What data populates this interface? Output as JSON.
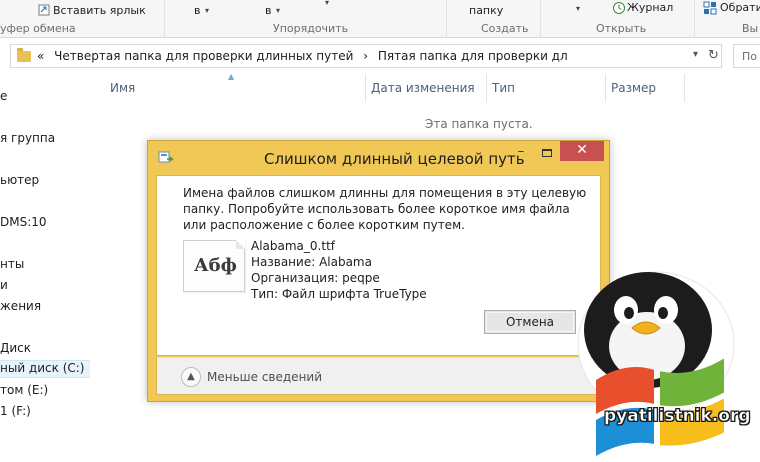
{
  "ribbon": {
    "paste_shortcut": "Вставить ярлык",
    "clipboard_group": "уфер обмена",
    "dd1": "в",
    "dd2": "в",
    "organize_group": "Упорядочить",
    "new_folder": "папку",
    "create_group": "Создать",
    "journal": "Журнал",
    "open_group": "Открыть",
    "access": "Обрати",
    "select_group": "Вы"
  },
  "address": {
    "crumbs": [
      "«",
      "Четвертая папка для проверки длинных путей",
      "›",
      "Пятая папка для проверки дл"
    ],
    "search_placeholder": "По"
  },
  "nav": {
    "items": [
      "е",
      "я группа",
      "ьютер",
      "DMS:10",
      "нты",
      "и",
      "жения",
      "Диск",
      "ный диск (C:)",
      "том (E:)",
      "1 (F:)"
    ]
  },
  "columns": {
    "name": "Имя",
    "date": "Дата изменения",
    "type": "Тип",
    "size": "Размер"
  },
  "empty_text": "Эта папка пуста.",
  "dialog": {
    "title": "Слишком длинный целевой путь",
    "minimize": "–",
    "close": "✕",
    "message": "Имена файлов слишком длинны для помещения в эту целевую папку. Попробуйте использовать более короткое имя файла или расположение с более коротким путем.",
    "icon_text": "Абф",
    "file": {
      "name": "Alabama_0.ttf",
      "title": "Название: Alabama",
      "org": "Организация: peqpe",
      "type": "Тип: Файл шрифта TrueType"
    },
    "cancel_label": "Отмена",
    "less_details": "Меньше сведений"
  },
  "logo": {
    "text": "pyatilistnik.org"
  },
  "colors": {
    "dialog_frame": "#f1c856",
    "close_red": "#c75050",
    "header_text": "#4c607a"
  }
}
